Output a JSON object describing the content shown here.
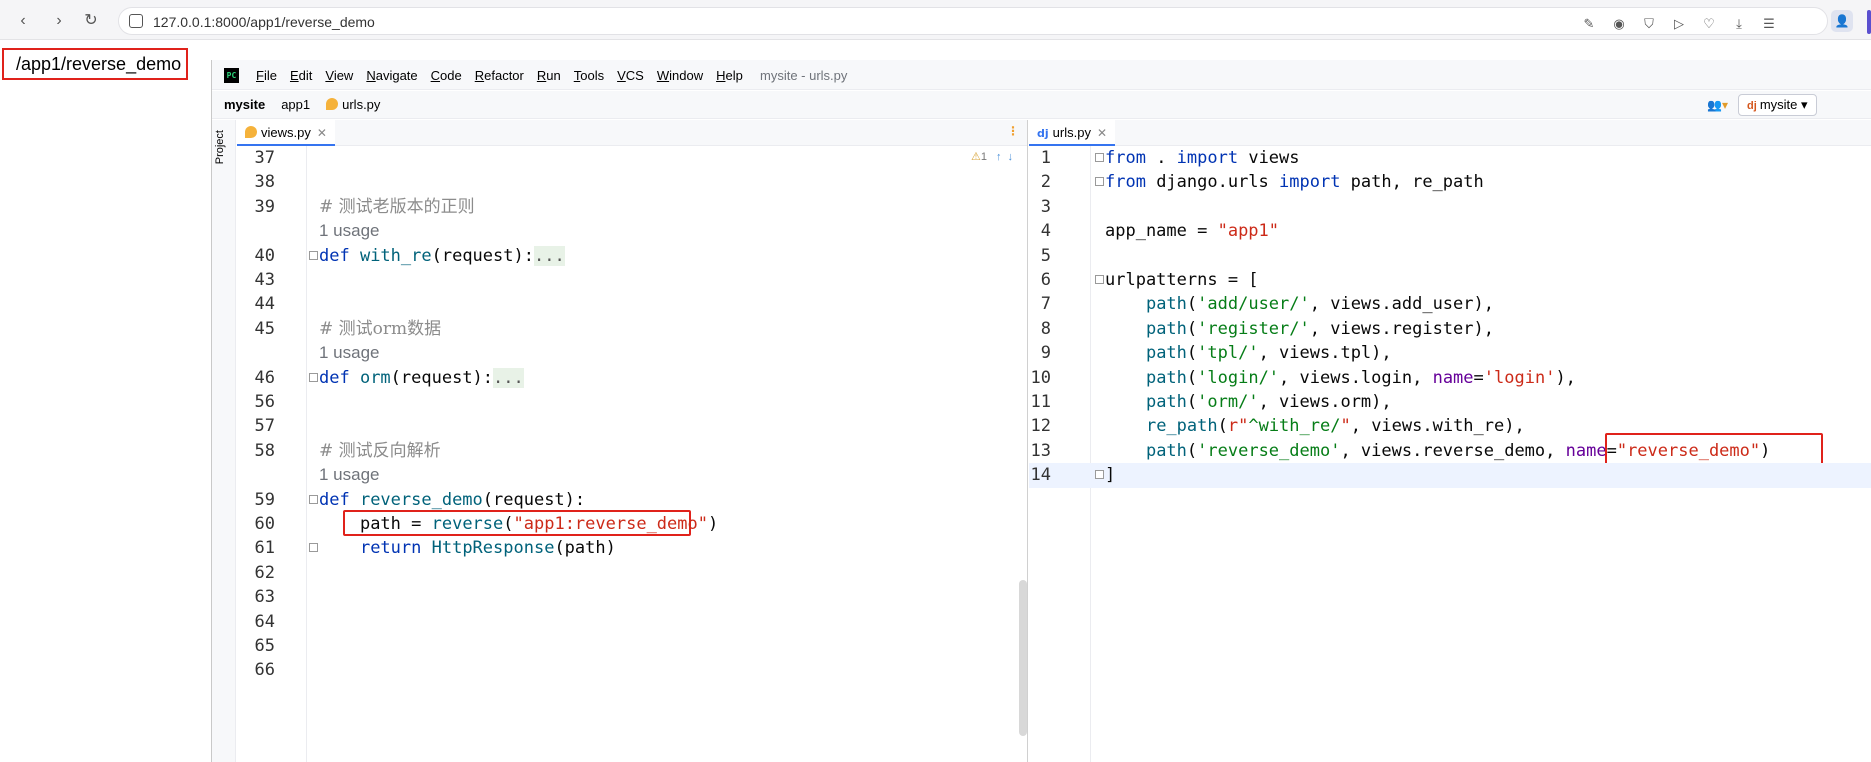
{
  "browser": {
    "url": "127.0.0.1:8000/app1/reverse_demo",
    "back_icon": "‹",
    "forward_icon": "›",
    "reload_icon": "↻"
  },
  "page": {
    "text": "/app1/reverse_demo"
  },
  "ide": {
    "logo": "PC",
    "menu": [
      "File",
      "Edit",
      "View",
      "Navigate",
      "Code",
      "Refactor",
      "Run",
      "Tools",
      "VCS",
      "Window",
      "Help"
    ],
    "window_title": "mysite - urls.py",
    "breadcrumbs": {
      "project": "mysite",
      "folder": "app1",
      "file": "urls.py"
    },
    "run_config": "mysite",
    "side_label": "Project"
  },
  "left_pane": {
    "tab": "views.py",
    "inspection_count": "1",
    "lines": [
      {
        "num": "37",
        "code": ""
      },
      {
        "num": "38",
        "code": ""
      },
      {
        "num": "39",
        "comment": "# 测试老版本的正则"
      },
      {
        "num": "",
        "usage": "1 usage"
      },
      {
        "num": "40",
        "def": "def ",
        "name": "with_re",
        "rest": "(request):",
        "fold": "..."
      },
      {
        "num": "43",
        "code": ""
      },
      {
        "num": "44",
        "code": ""
      },
      {
        "num": "45",
        "comment": "# 测试orm数据"
      },
      {
        "num": "",
        "usage": "1 usage"
      },
      {
        "num": "46",
        "def": "def ",
        "name": "orm",
        "rest": "(request):",
        "fold": "..."
      },
      {
        "num": "56",
        "code": ""
      },
      {
        "num": "57",
        "code": ""
      },
      {
        "num": "58",
        "comment": "# 测试反向解析"
      },
      {
        "num": "",
        "usage": "1 usage"
      },
      {
        "num": "59",
        "def": "def ",
        "name": "reverse_demo",
        "rest": "(request):",
        "fold": ""
      },
      {
        "num": "60",
        "line60": true
      },
      {
        "num": "61",
        "line61": true
      },
      {
        "num": "62",
        "code": ""
      },
      {
        "num": "63",
        "code": ""
      },
      {
        "num": "64",
        "code": ""
      },
      {
        "num": "65",
        "code": ""
      },
      {
        "num": "66",
        "code": ""
      }
    ],
    "line60": {
      "indent": "    ",
      "var": "path = ",
      "fn": "reverse",
      "open": "(",
      "str": "\"app1:reverse_demo\"",
      "close": ")"
    },
    "line61": {
      "indent": "    ",
      "kw": "return ",
      "fn": "HttpResponse",
      "rest": "(path)"
    }
  },
  "right_pane": {
    "tab": "urls.py",
    "tab_icon": "dj",
    "lines": [
      {
        "num": "1",
        "parts": [
          [
            "kw",
            "from"
          ],
          [
            "plain",
            " . "
          ],
          [
            "kw",
            "import"
          ],
          [
            "plain",
            " views"
          ]
        ]
      },
      {
        "num": "2",
        "parts": [
          [
            "kw",
            "from"
          ],
          [
            "plain",
            " django.urls "
          ],
          [
            "kw",
            "import"
          ],
          [
            "plain",
            " path, re_path"
          ]
        ]
      },
      {
        "num": "3",
        "parts": []
      },
      {
        "num": "4",
        "parts": [
          [
            "plain",
            "app_name = "
          ],
          [
            "strr",
            "\"app1\""
          ]
        ]
      },
      {
        "num": "5",
        "parts": []
      },
      {
        "num": "6",
        "parts": [
          [
            "plain",
            "urlpatterns = ["
          ]
        ]
      },
      {
        "num": "7",
        "parts": [
          [
            "plain",
            "    "
          ],
          [
            "fn",
            "path"
          ],
          [
            "plain",
            "("
          ],
          [
            "str",
            "'add/user/'"
          ],
          [
            "plain",
            ", views.add_user),"
          ]
        ]
      },
      {
        "num": "8",
        "parts": [
          [
            "plain",
            "    "
          ],
          [
            "fn",
            "path"
          ],
          [
            "plain",
            "("
          ],
          [
            "str",
            "'register/'"
          ],
          [
            "plain",
            ", views.register),"
          ]
        ]
      },
      {
        "num": "9",
        "parts": [
          [
            "plain",
            "    "
          ],
          [
            "fn",
            "path"
          ],
          [
            "plain",
            "("
          ],
          [
            "str",
            "'tpl/'"
          ],
          [
            "plain",
            ", views.tpl),"
          ]
        ]
      },
      {
        "num": "10",
        "parts": [
          [
            "plain",
            "    "
          ],
          [
            "fn",
            "path"
          ],
          [
            "plain",
            "("
          ],
          [
            "str",
            "'login/'"
          ],
          [
            "plain",
            ", views.login, "
          ],
          [
            "param",
            "name"
          ],
          [
            "plain",
            "="
          ],
          [
            "strr",
            "'login'"
          ],
          [
            "plain",
            "),"
          ]
        ]
      },
      {
        "num": "11",
        "parts": [
          [
            "plain",
            "    "
          ],
          [
            "fn",
            "path"
          ],
          [
            "plain",
            "("
          ],
          [
            "str",
            "'orm/'"
          ],
          [
            "plain",
            ", views.orm),"
          ]
        ]
      },
      {
        "num": "12",
        "parts": [
          [
            "plain",
            "    "
          ],
          [
            "fn",
            "re_path"
          ],
          [
            "plain",
            "("
          ],
          [
            "strr",
            "r\""
          ],
          [
            "str",
            "^with_re/"
          ],
          [
            "strr",
            "\""
          ],
          [
            "plain",
            ", views.with_re),"
          ]
        ]
      },
      {
        "num": "13",
        "parts": [
          [
            "plain",
            "    "
          ],
          [
            "fn",
            "path"
          ],
          [
            "plain",
            "("
          ],
          [
            "str",
            "'reverse_demo'"
          ],
          [
            "plain",
            ", views.reverse_demo, "
          ],
          [
            "param",
            "name"
          ],
          [
            "plain",
            "="
          ],
          [
            "strr",
            "\"reverse_demo\""
          ],
          [
            "plain",
            ")"
          ]
        ]
      },
      {
        "num": "14",
        "parts": [
          [
            "plain",
            "]"
          ]
        ]
      }
    ]
  }
}
